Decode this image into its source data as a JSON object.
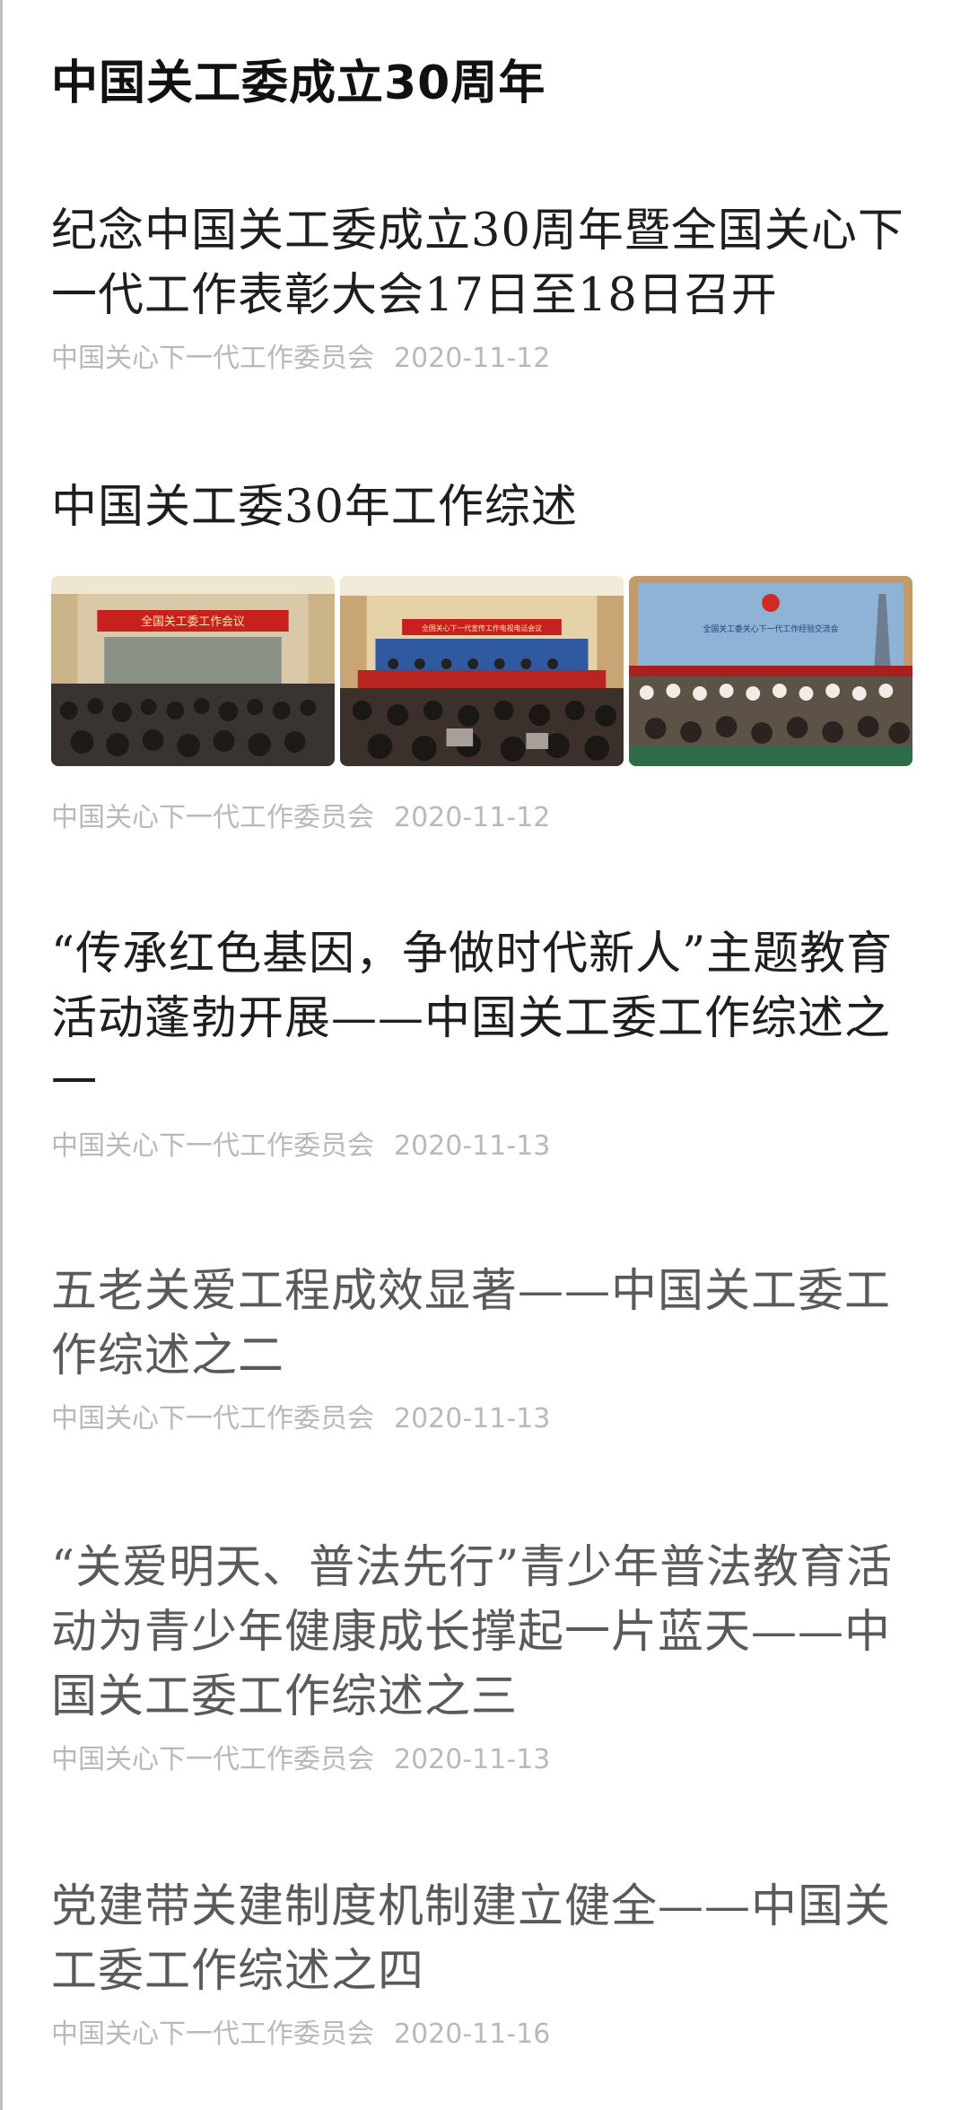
{
  "page": {
    "title": "中国关工委成立30周年"
  },
  "articles": [
    {
      "title": "纪念中国关工委成立30周年暨全国关心下一代工作表彰大会17日至18日召开",
      "source": "中国关心下一代工作委员会",
      "date": "2020-11-12"
    },
    {
      "title": "中国关工委30年工作综述",
      "source": "中国关心下一代工作委员会",
      "date": "2020-11-12",
      "images": [
        {
          "banner": "全国关工委工作会议",
          "icon": "conference-photo-icon"
        },
        {
          "banner": "全国关心下一代宣传工作电视电话会议",
          "icon": "conference-photo-icon"
        },
        {
          "banner": "全国关工委关心下一代工作经验交流会",
          "icon": "conference-photo-icon"
        }
      ]
    },
    {
      "title": "“传承红色基因，争做时代新人”主题教育活动蓬勃开展——中国关工委工作综述之一",
      "source": "中国关心下一代工作委员会",
      "date": "2020-11-13"
    },
    {
      "title": "五老关爱工程成效显著——中国关工委工作综述之二",
      "source": "中国关心下一代工作委员会",
      "date": "2020-11-13"
    },
    {
      "title": "“关爱明天、普法先行”青少年普法教育活动为青少年健康成长撑起一片蓝天——中国关工委工作综述之三",
      "source": "中国关心下一代工作委员会",
      "date": "2020-11-13"
    },
    {
      "title": "党建带关建制度机制建立健全——中国关工委工作综述之四",
      "source": "中国关心下一代工作委员会",
      "date": "2020-11-16"
    }
  ],
  "colors": {
    "title": "#111111",
    "meta": "#b9b9b9",
    "banner_red": "#c8201e"
  }
}
